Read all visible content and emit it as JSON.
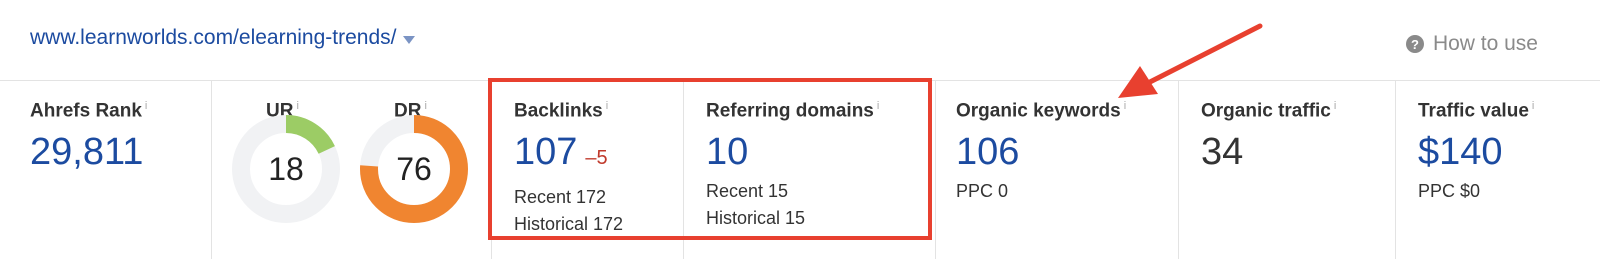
{
  "url": "www.learnworlds.com/elearning-trends/",
  "help_label": "How to use",
  "metrics": {
    "ahrefs_rank": {
      "label": "Ahrefs Rank",
      "value": "29,811"
    },
    "ur": {
      "label": "UR",
      "value": "18",
      "fraction": 0.18,
      "color": "#9ccc65"
    },
    "dr": {
      "label": "DR",
      "value": "76",
      "fraction": 0.76,
      "color": "#f08530"
    },
    "backlinks": {
      "label": "Backlinks",
      "value": "107",
      "delta": "–5",
      "recent": "Recent 172",
      "historical": "Historical 172"
    },
    "referring_domains": {
      "label": "Referring domains",
      "value": "10",
      "recent": "Recent 15",
      "historical": "Historical 15"
    },
    "organic_keywords": {
      "label": "Organic keywords",
      "value": "106",
      "ppc": "PPC 0"
    },
    "organic_traffic": {
      "label": "Organic traffic",
      "value": "34"
    },
    "traffic_value": {
      "label": "Traffic value",
      "value": "$140",
      "ppc": "PPC $0"
    }
  },
  "info_glyph": "i",
  "colors": {
    "link": "#1c4ba0",
    "highlight": "#e8402f",
    "delta": "#c0392b"
  }
}
